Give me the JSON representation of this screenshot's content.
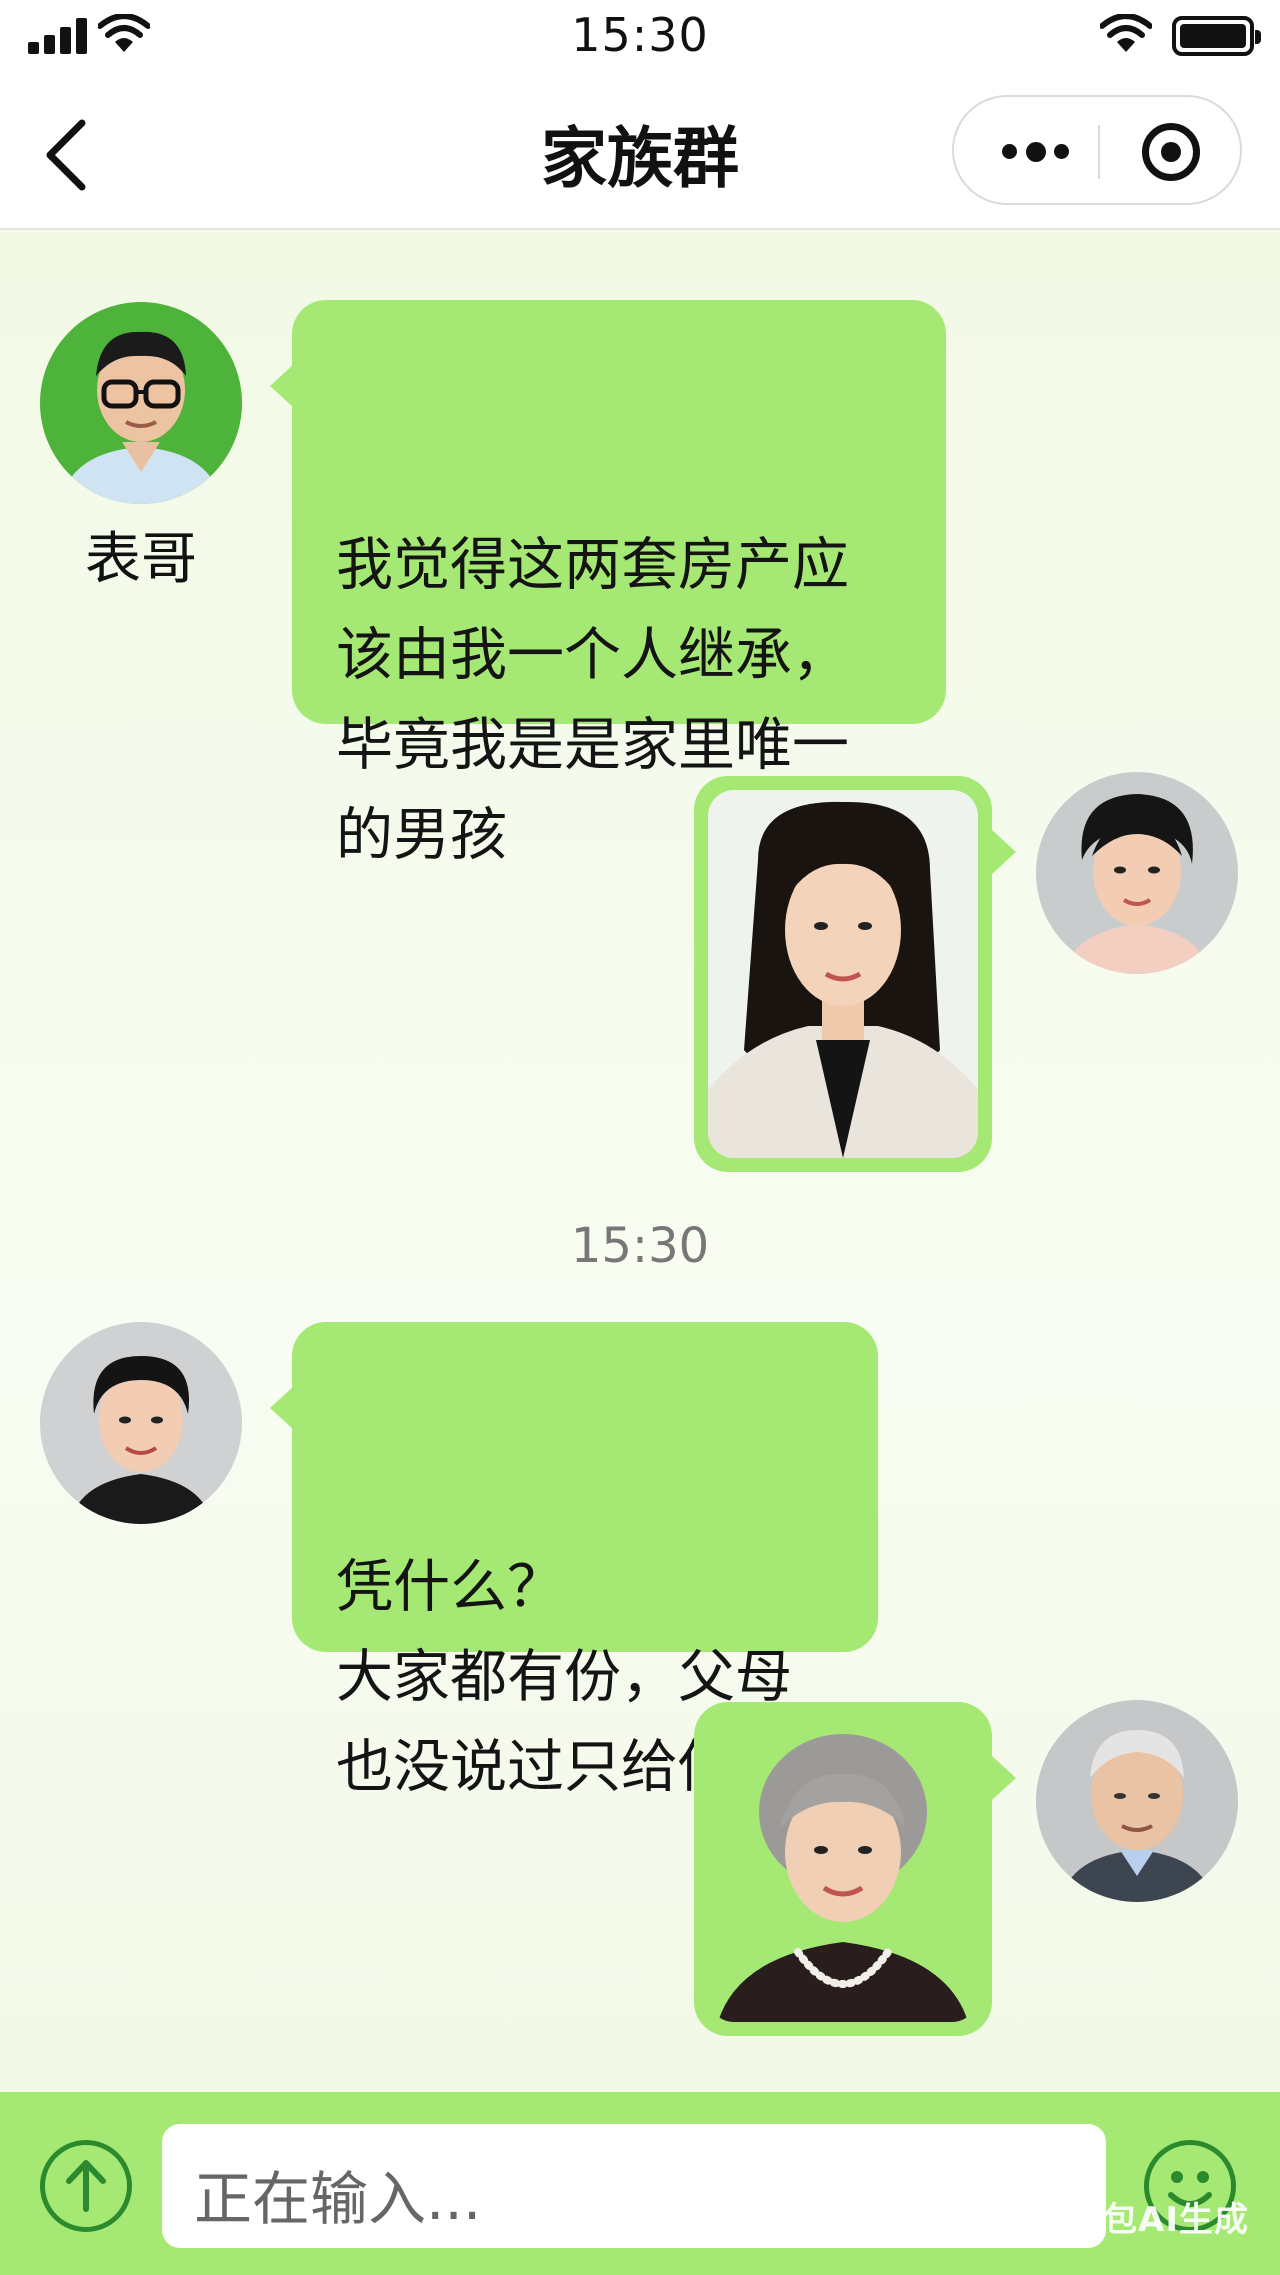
{
  "status_bar": {
    "time": "15:30"
  },
  "header": {
    "title": "家族群"
  },
  "messages": [
    {
      "sender": "表哥",
      "side": "left",
      "type": "text",
      "text": "我觉得这两套房产应\n该由我一个人继承，\n毕竟我是是家里唯一\n的男孩"
    },
    {
      "side": "right",
      "type": "image"
    },
    {
      "side": "left",
      "type": "text",
      "text": "凭什么？\n大家都有份，父母\n也没说过只给你"
    },
    {
      "side": "right",
      "type": "image"
    }
  ],
  "timestamp": "15:30",
  "input": {
    "placeholder": "正在输入..."
  },
  "watermark": "豆包AI生成",
  "colors": {
    "bubble": "#a5e873",
    "accent": "#2b8a2e",
    "background": "#f6fbef"
  },
  "icons": [
    "signal-icon",
    "wifi-icon",
    "battery-icon",
    "back-icon",
    "more-icon",
    "target-icon",
    "upload-icon",
    "emoji-icon"
  ]
}
